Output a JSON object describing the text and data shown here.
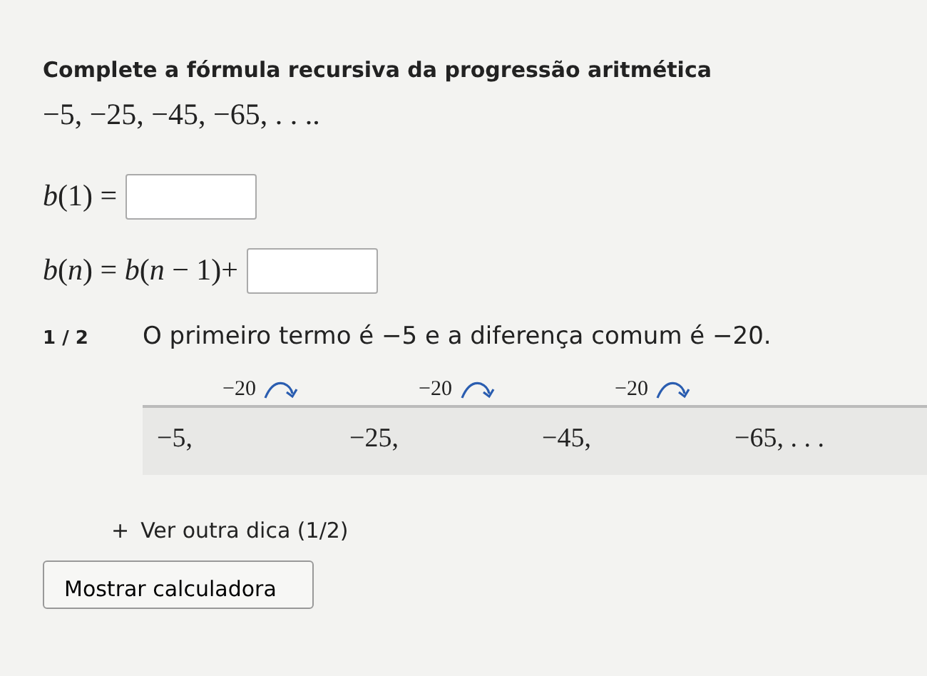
{
  "question": {
    "title": "Complete a fórmula recursiva da progressão aritmética",
    "sequence": "−5, −25, −45, −65, . . .."
  },
  "equations": [
    {
      "expression": "*b*(1) ="
    },
    {
      "expression": "*b*(*n*) = *b*(*n* − 1)+"
    }
  ],
  "hint": {
    "counter": "1 / 2",
    "text": "O primeiro termo é −5 e a diferença comum é −20.",
    "steps": [
      "−20",
      "−20",
      "−20"
    ],
    "terms": [
      "−5,",
      "−25,",
      "−45,",
      "−65, . . ."
    ]
  },
  "more_hints": {
    "icon": "+",
    "label": "Ver outra dica (1/2)"
  },
  "calculator_button": {
    "label": "Mostrar calculadora"
  }
}
